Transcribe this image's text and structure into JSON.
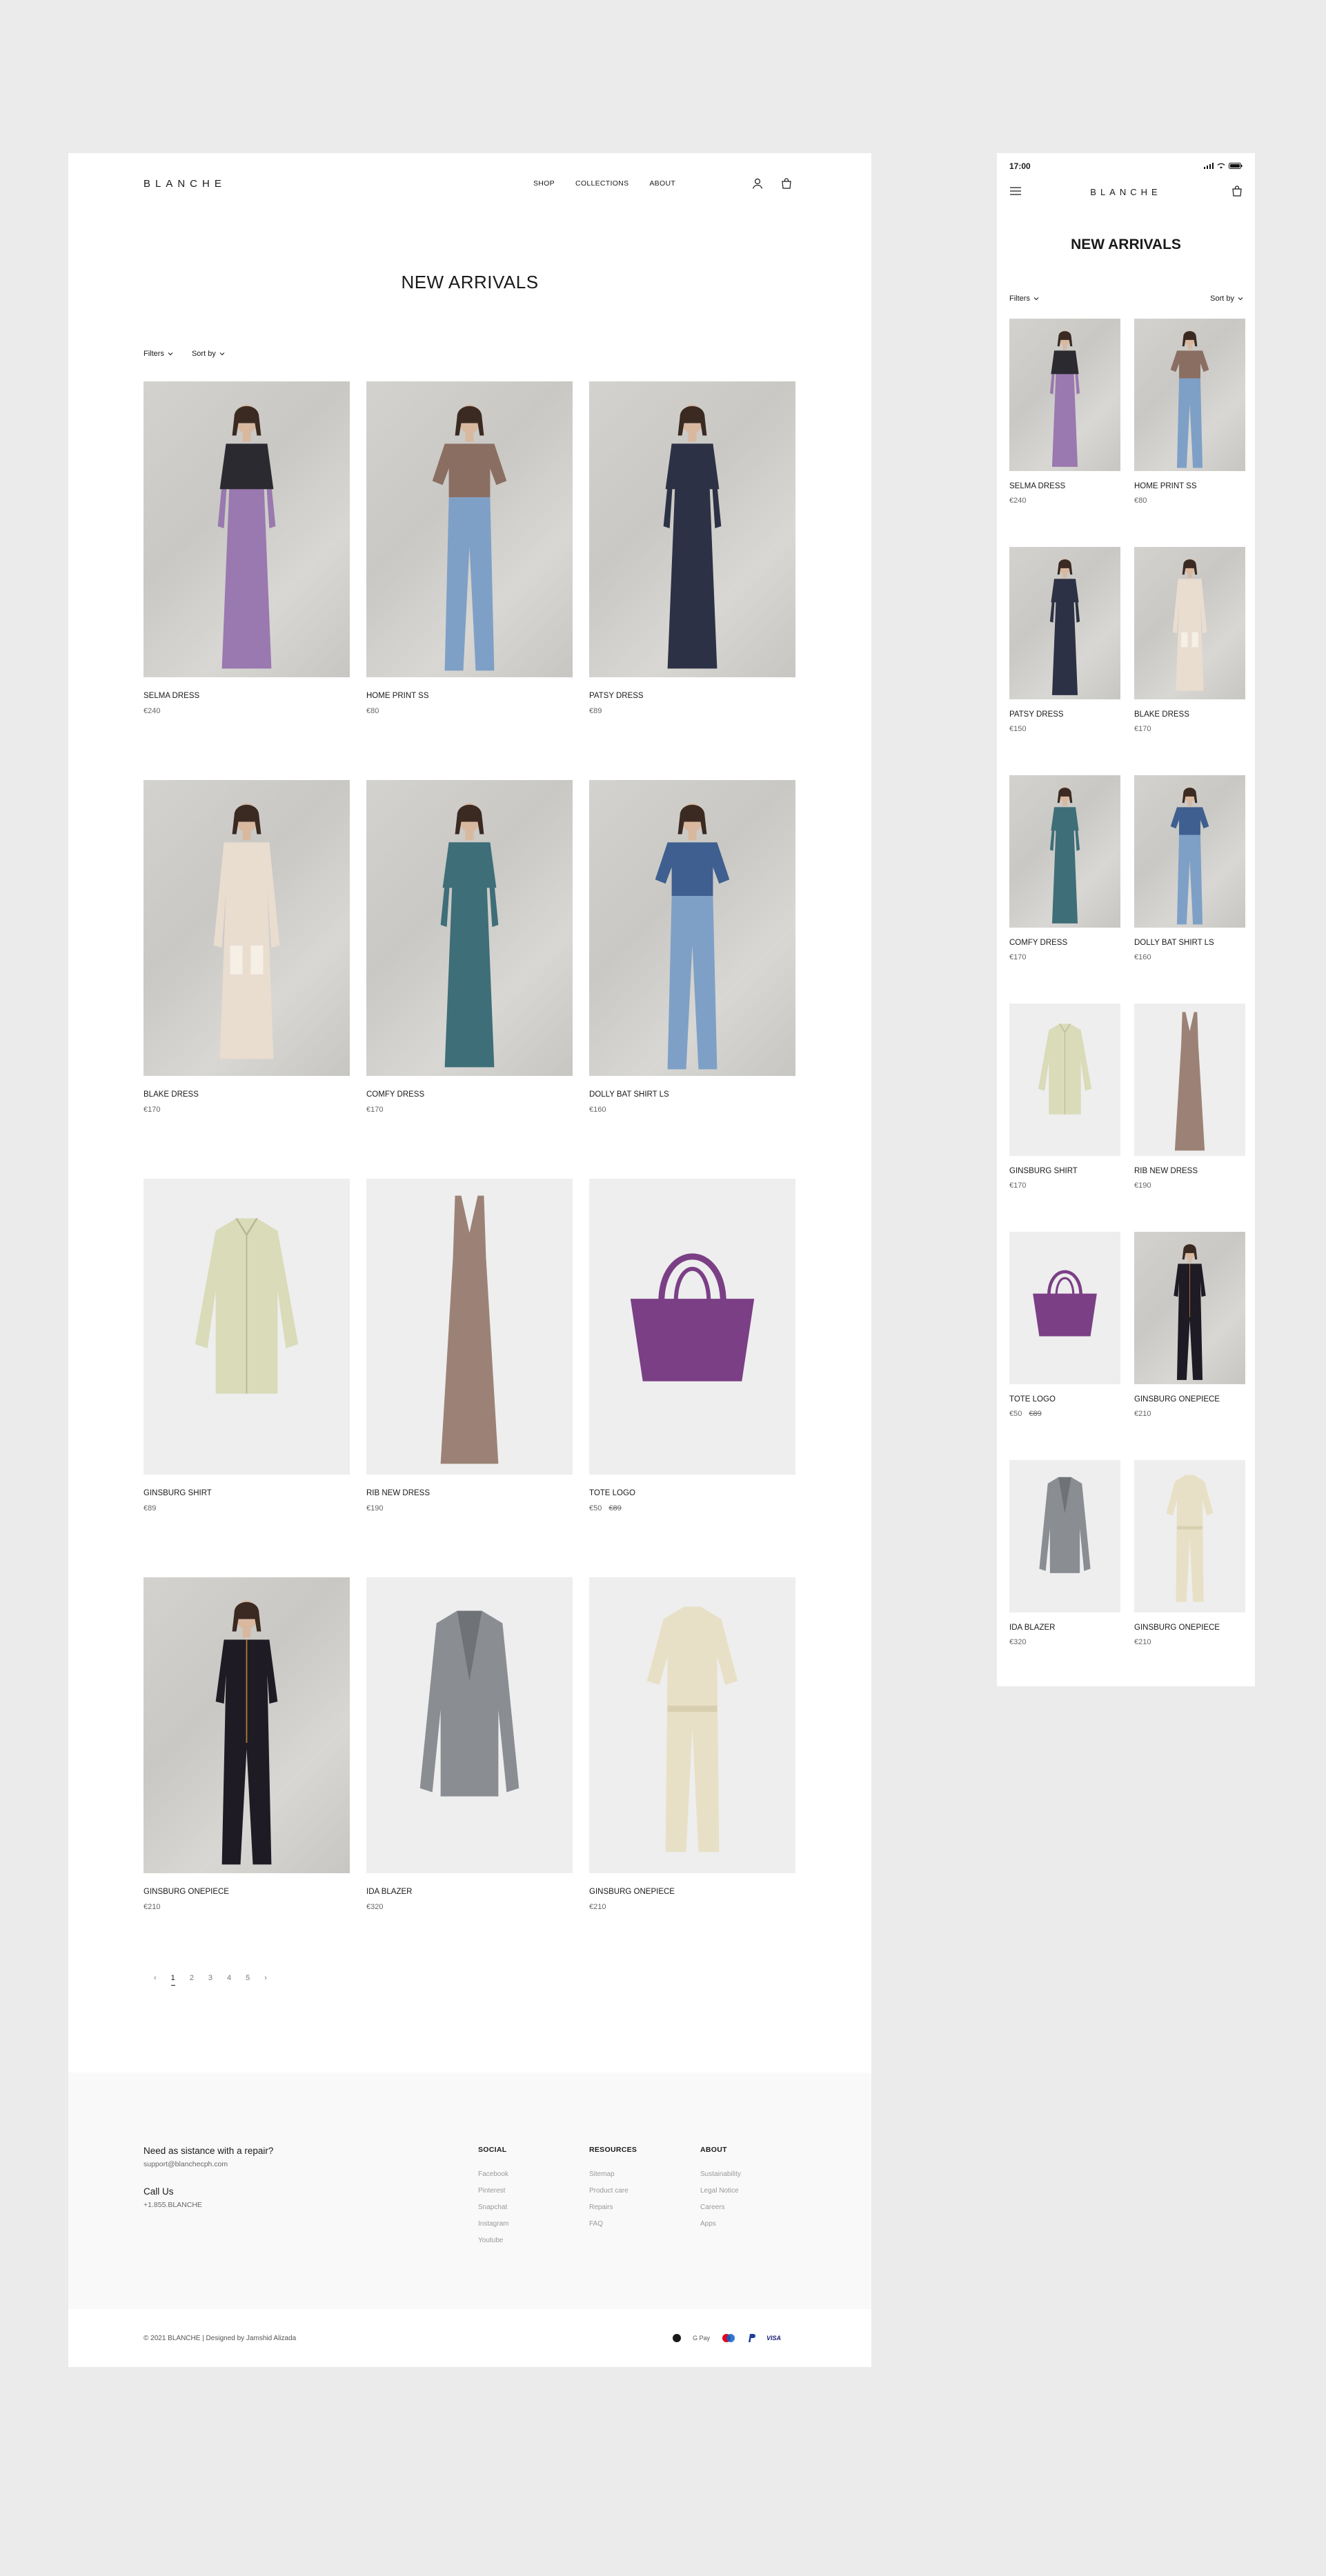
{
  "brand": "BLANCHE",
  "nav": {
    "shop": "SHOP",
    "collections": "COLLECTIONS",
    "about": "ABOUT"
  },
  "page_title": "NEW ARRIVALS",
  "filters": {
    "filters_label": "Filters",
    "sort_label": "Sort by"
  },
  "desktop_products": [
    {
      "name": "SELMA DRESS",
      "price": "€240",
      "old_price": "",
      "kind": "dress",
      "bg": "photo",
      "color": "#9a78b0",
      "top": "#2a2a30"
    },
    {
      "name": "HOME PRINT SS",
      "price": "€80",
      "old_price": "",
      "kind": "tee-jeans",
      "bg": "photo",
      "color": "#8b6e62",
      "top": "#8b6e62"
    },
    {
      "name": "PATSY DRESS",
      "price": "€89",
      "old_price": "",
      "kind": "dress",
      "bg": "photo",
      "color": "#2d3145",
      "top": "#2d3145"
    },
    {
      "name": "BLAKE DRESS",
      "price": "€170",
      "old_price": "",
      "kind": "coat",
      "bg": "photo",
      "color": "#e9ddd0",
      "top": "#e9ddd0"
    },
    {
      "name": "COMFY DRESS",
      "price": "€170",
      "old_price": "",
      "kind": "dress",
      "bg": "photo",
      "color": "#3e6e78",
      "top": "#3e6e78"
    },
    {
      "name": "DOLLY BAT SHIRT LS",
      "price": "€160",
      "old_price": "",
      "kind": "tee-jeans",
      "bg": "photo",
      "color": "#3e5f8f",
      "top": "#3e5f8f"
    },
    {
      "name": "GINSBURG SHIRT",
      "price": "€89",
      "old_price": "",
      "kind": "shirt",
      "bg": "studio",
      "color": "#d9dbb9",
      "top": "#d9dbb9"
    },
    {
      "name": "RIB NEW DRESS",
      "price": "€190",
      "old_price": "",
      "kind": "slip",
      "bg": "studio",
      "color": "#9c8276",
      "top": "#9c8276"
    },
    {
      "name": "TOTE LOGO",
      "price": "€50",
      "old_price": "€89",
      "kind": "tote",
      "bg": "studio",
      "color": "#7b3f86",
      "top": "#7b3f86"
    },
    {
      "name": "GINSBURG ONEPIECE",
      "price": "€210",
      "old_price": "",
      "kind": "jumpsuit",
      "bg": "photo",
      "color": "#1e1b24",
      "top": "#1e1b24"
    },
    {
      "name": "IDA BLAZER",
      "price": "€320",
      "old_price": "",
      "kind": "blazer",
      "bg": "studio",
      "color": "#8a8d92",
      "top": "#8a8d92"
    },
    {
      "name": "GINSBURG ONEPIECE",
      "price": "€210",
      "old_price": "",
      "kind": "jumpsuit-flat",
      "bg": "studio",
      "color": "#e8e0c6",
      "top": "#e8e0c6"
    }
  ],
  "mobile_products": [
    {
      "name": "SELMA DRESS",
      "price": "€240",
      "old_price": "",
      "kind": "dress",
      "bg": "photo",
      "color": "#9a78b0",
      "top": "#2a2a30"
    },
    {
      "name": "HOME PRINT SS",
      "price": "€80",
      "old_price": "",
      "kind": "tee-jeans",
      "bg": "photo",
      "color": "#8b6e62",
      "top": "#8b6e62"
    },
    {
      "name": "PATSY DRESS",
      "price": "€150",
      "old_price": "",
      "kind": "dress",
      "bg": "photo",
      "color": "#2d3145",
      "top": "#2d3145"
    },
    {
      "name": "BLAKE DRESS",
      "price": "€170",
      "old_price": "",
      "kind": "coat",
      "bg": "photo",
      "color": "#e9ddd0",
      "top": "#e9ddd0"
    },
    {
      "name": "COMFY DRESS",
      "price": "€170",
      "old_price": "",
      "kind": "dress",
      "bg": "photo",
      "color": "#3e6e78",
      "top": "#3e6e78"
    },
    {
      "name": "DOLLY BAT SHIRT LS",
      "price": "€160",
      "old_price": "",
      "kind": "tee-jeans",
      "bg": "photo",
      "color": "#3e5f8f",
      "top": "#3e5f8f"
    },
    {
      "name": "GINSBURG SHIRT",
      "price": "€170",
      "old_price": "",
      "kind": "shirt",
      "bg": "studio",
      "color": "#d9dbb9",
      "top": "#d9dbb9"
    },
    {
      "name": "RIB NEW DRESS",
      "price": "€190",
      "old_price": "",
      "kind": "slip",
      "bg": "studio",
      "color": "#9c8276",
      "top": "#9c8276"
    },
    {
      "name": "TOTE LOGO",
      "price": "€50",
      "old_price": "€89",
      "kind": "tote",
      "bg": "studio",
      "color": "#7b3f86",
      "top": "#7b3f86"
    },
    {
      "name": "GINSBURG ONEPIECE",
      "price": "€210",
      "old_price": "",
      "kind": "jumpsuit",
      "bg": "photo",
      "color": "#1e1b24",
      "top": "#1e1b24"
    },
    {
      "name": "IDA BLAZER",
      "price": "€320",
      "old_price": "",
      "kind": "blazer",
      "bg": "studio",
      "color": "#8a8d92",
      "top": "#8a8d92"
    },
    {
      "name": "GINSBURG ONEPIECE",
      "price": "€210",
      "old_price": "",
      "kind": "jumpsuit-flat",
      "bg": "studio",
      "color": "#e8e0c6",
      "top": "#e8e0c6"
    }
  ],
  "pagination": {
    "prev": "‹",
    "pages": [
      "1",
      "2",
      "3",
      "4",
      "5"
    ],
    "active": "1",
    "next": "›"
  },
  "footer": {
    "repair_heading": "Need as sistance with a repair?",
    "support_email": "support@blanchecph.com",
    "call_heading": "Call Us",
    "phone": "+1.855.BLANCHE",
    "columns": [
      {
        "title": "SOCIAL",
        "links": [
          "Facebook",
          "Pinterest",
          "Snapchat",
          "Instagram",
          "Youtube"
        ]
      },
      {
        "title": "RESOURCES",
        "links": [
          "Sitemap",
          "Product care",
          "Repairs",
          "FAQ"
        ]
      },
      {
        "title": "ABOUT",
        "links": [
          "Sustainability",
          "Legal Notice",
          "Careers",
          "Apps"
        ]
      }
    ],
    "copyright": "© 2021 BLANCHE | Designed by Jamshid Alizada",
    "payments": [
      "Apple Pay",
      "G Pay",
      "Mastercard",
      "PayPal",
      "VISA"
    ]
  },
  "mobile": {
    "status_time": "17:00"
  },
  "colors": {
    "page_bg": "#ebebeb",
    "footer_bg": "#f9f9f9",
    "text": "#1a1a1a",
    "muted": "#666666"
  }
}
